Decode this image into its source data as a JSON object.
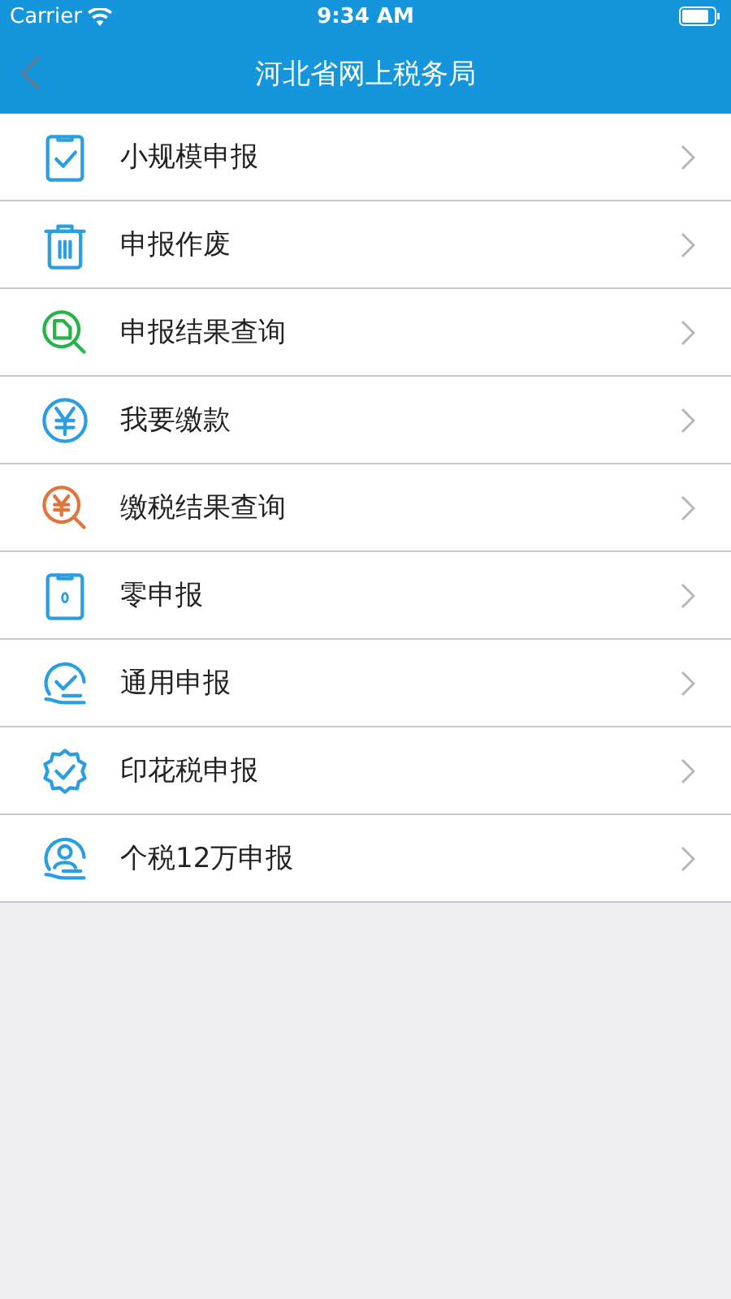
{
  "status_bar": {
    "carrier": "Carrier",
    "time": "9:34 AM"
  },
  "nav_bar": {
    "title": "河北省网上税务局"
  },
  "menu": [
    {
      "label": "小规模申报",
      "kind": "clipboard-check"
    },
    {
      "label": "申报作废",
      "kind": "trash"
    },
    {
      "label": "申报结果查询",
      "kind": "doc-search"
    },
    {
      "label": "我要缴款",
      "kind": "yen"
    },
    {
      "label": "缴税结果查询",
      "kind": "yen-search"
    },
    {
      "label": "零申报",
      "kind": "clipboard-zero"
    },
    {
      "label": "通用申报",
      "kind": "hand-check"
    },
    {
      "label": "印花税申报",
      "kind": "badge-check"
    },
    {
      "label": "个税12万申报",
      "kind": "hand-person"
    }
  ]
}
